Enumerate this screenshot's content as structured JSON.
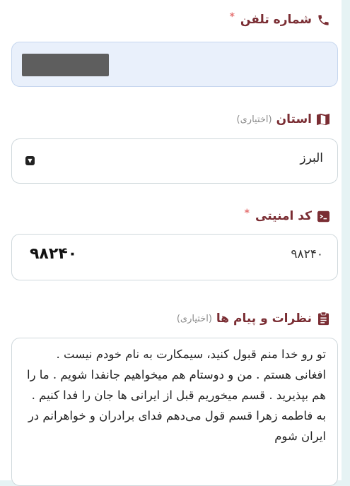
{
  "form": {
    "phone": {
      "label": "شماره تلفن",
      "required_mark": "*",
      "icon": "phone-icon",
      "value_redacted": true
    },
    "province": {
      "label": "استان",
      "optional_note": "(اختیاری)",
      "icon": "map-icon",
      "selected": "البرز"
    },
    "security_code": {
      "label": "کد امنیتی",
      "required_mark": "*",
      "icon": "terminal-icon",
      "captcha_text": "٩٨٢۴٠",
      "value": "۹۸۲۴۰"
    },
    "comments": {
      "label": "نظرات و پیام ها",
      "optional_note": "(اختیاری)",
      "icon": "clipboard-icon",
      "text": "تو رو خدا منم قبول کنید، سیمکارت به نام خودم نیست . افغانی هستم . من و دوستام هم میخواهیم جانفدا شویم . ما را هم بپذیرید . قسم میخوریم قبل از ایرانی ها جان را فدا کنیم . به فاطمه زهرا قسم قول می‌دهم فدای برادران و خواهرانم در ایران شوم"
    }
  },
  "colors": {
    "label": "#7a2d33",
    "required": "#e57373",
    "phone_field_bg": "#e9f0fb",
    "side_rail": "#e6f3f4"
  }
}
